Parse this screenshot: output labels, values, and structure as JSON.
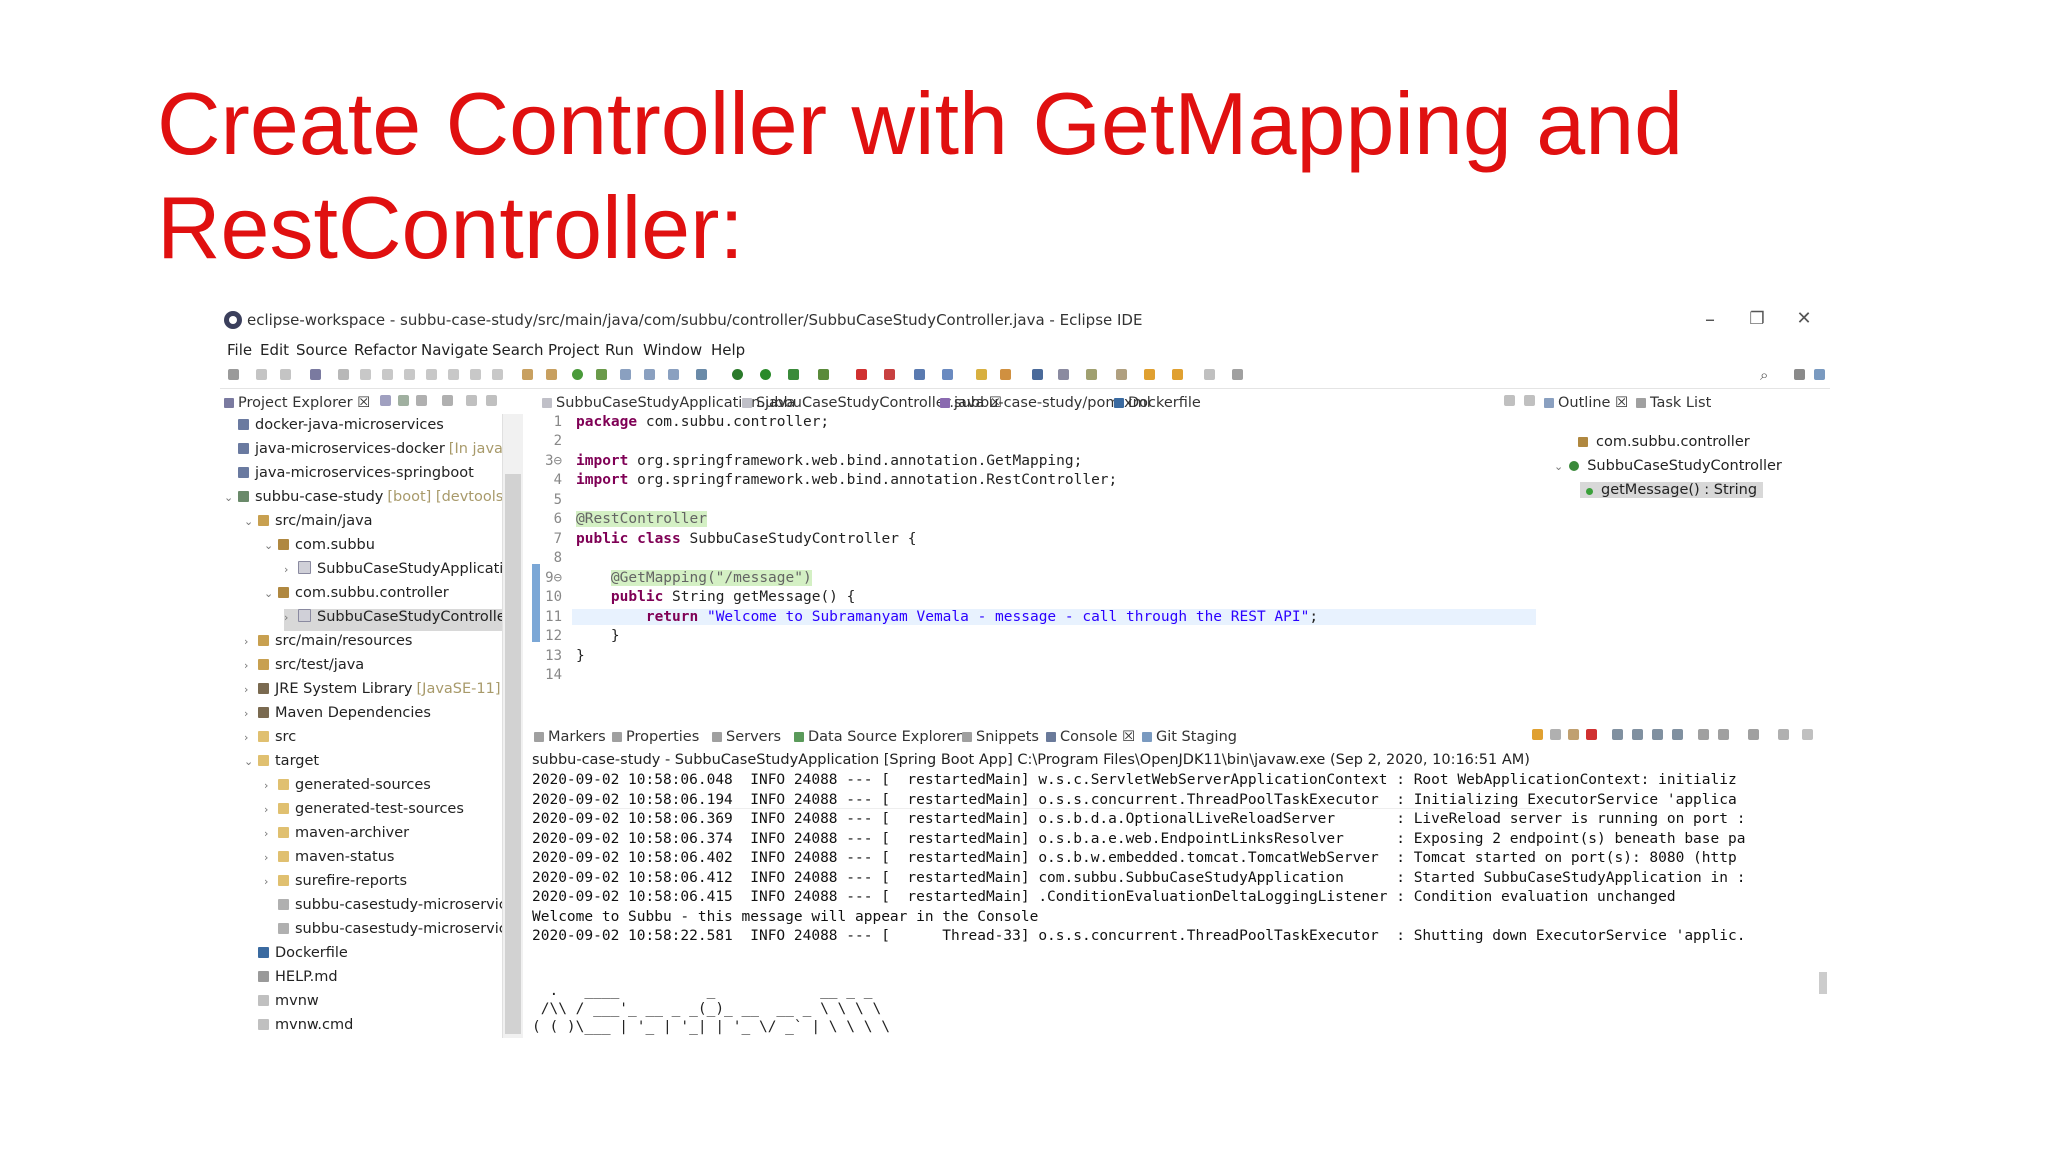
{
  "slide": {
    "title_line1": "Create Controller with GetMapping and",
    "title_line2": "RestController:"
  },
  "window": {
    "title": "eclipse-workspace - subbu-case-study/src/main/java/com/subbu/controller/SubbuCaseStudyController.java - Eclipse IDE",
    "minimize": "–",
    "restore": "❐",
    "close": "✕"
  },
  "menu": [
    "File",
    "Edit",
    "Source",
    "Refactor",
    "Navigate",
    "Search",
    "Project",
    "Run",
    "Window",
    "Help"
  ],
  "project_explorer": {
    "tab_label": "Project Explorer ☒",
    "tree": [
      {
        "label": "docker-java-microservices",
        "extra": ""
      },
      {
        "label": "java-microservices-docker",
        "extra": "[In java-n"
      },
      {
        "label": "java-microservices-springboot",
        "extra": ""
      },
      {
        "label": "subbu-case-study",
        "extra": "[boot] [devtools]"
      },
      {
        "label": "src/main/java",
        "extra": ""
      },
      {
        "label": "com.subbu",
        "extra": ""
      },
      {
        "label": "SubbuCaseStudyApplicatio",
        "extra": ""
      },
      {
        "label": "com.subbu.controller",
        "extra": ""
      },
      {
        "label": "SubbuCaseStudyController",
        "extra": ""
      },
      {
        "label": "src/main/resources",
        "extra": ""
      },
      {
        "label": "src/test/java",
        "extra": ""
      },
      {
        "label": "JRE System Library",
        "extra": "[JavaSE-11]"
      },
      {
        "label": "Maven Dependencies",
        "extra": ""
      },
      {
        "label": "src",
        "extra": ""
      },
      {
        "label": "target",
        "extra": ""
      },
      {
        "label": "generated-sources",
        "extra": ""
      },
      {
        "label": "generated-test-sources",
        "extra": ""
      },
      {
        "label": "maven-archiver",
        "extra": ""
      },
      {
        "label": "maven-status",
        "extra": ""
      },
      {
        "label": "surefire-reports",
        "extra": ""
      },
      {
        "label": "subbu-casestudy-microservic",
        "extra": ""
      },
      {
        "label": "subbu-casestudy-microservic",
        "extra": ""
      },
      {
        "label": "Dockerfile",
        "extra": ""
      },
      {
        "label": "HELP.md",
        "extra": ""
      },
      {
        "label": "mvnw",
        "extra": ""
      },
      {
        "label": "mvnw.cmd",
        "extra": ""
      }
    ]
  },
  "editor": {
    "tabs": [
      "SubbuCaseStudyApplication.java",
      "SubbuCaseStudyController.java ☒",
      "subbu-case-study/pom.xml",
      "Dockerfile"
    ],
    "line_numbers": [
      "1",
      "2",
      "3⊖",
      "4",
      "5",
      "6",
      "7",
      "8",
      "9⊖",
      "10",
      "11",
      "12",
      "13",
      "14"
    ],
    "code": {
      "l1_kw": "package",
      "l1_rest": " com.subbu.controller;",
      "l3_kw": "import",
      "l3_rest": " org.springframework.web.bind.annotation.GetMapping;",
      "l4_kw": "import",
      "l4_rest": " org.springframework.web.bind.annotation.RestController;",
      "l6_ann": "@RestController",
      "l7_kw": "public class",
      "l7_rest": " SubbuCaseStudyController {",
      "l9_indent": "    ",
      "l9_ann": "@GetMapping(\"/message\")",
      "l10_indent": "    ",
      "l10_kw": "public",
      "l10_rest": " String getMessage() {",
      "l11_indent": "        ",
      "l11_kw": "return",
      "l11_sp": " ",
      "l11_str": "\"Welcome to Subramanyam Vemala - message - call through the REST API\"",
      "l11_end": ";",
      "l12": "    }",
      "l13": "}"
    }
  },
  "outline": {
    "tabs": [
      "Outline ☒",
      "Task List"
    ],
    "items": [
      "com.subbu.controller",
      "SubbuCaseStudyController",
      "getMessage() : String"
    ]
  },
  "console": {
    "tabs": [
      "Markers",
      "Properties",
      "Servers",
      "Data Source Explorer",
      "Snippets",
      "Console ☒",
      "Git Staging"
    ],
    "description": "subbu-case-study - SubbuCaseStudyApplication [Spring Boot App] C:\\Program Files\\OpenJDK11\\bin\\javaw.exe  (Sep 2, 2020, 10:16:51 AM)",
    "lines": [
      "2020-09-02 10:58:06.048  INFO 24088 --- [  restartedMain] w.s.c.ServletWebServerApplicationContext : Root WebApplicationContext: initializ",
      "2020-09-02 10:58:06.194  INFO 24088 --- [  restartedMain] o.s.s.concurrent.ThreadPoolTaskExecutor  : Initializing ExecutorService 'applica",
      "2020-09-02 10:58:06.369  INFO 24088 --- [  restartedMain] o.s.b.d.a.OptionalLiveReloadServer       : LiveReload server is running on port :",
      "2020-09-02 10:58:06.374  INFO 24088 --- [  restartedMain] o.s.b.a.e.web.EndpointLinksResolver      : Exposing 2 endpoint(s) beneath base pa",
      "2020-09-02 10:58:06.402  INFO 24088 --- [  restartedMain] o.s.b.w.embedded.tomcat.TomcatWebServer  : Tomcat started on port(s): 8080 (http",
      "2020-09-02 10:58:06.412  INFO 24088 --- [  restartedMain] com.subbu.SubbuCaseStudyApplication      : Started SubbuCaseStudyApplication in :",
      "2020-09-02 10:58:06.415  INFO 24088 --- [  restartedMain] .ConditionEvaluationDeltaLoggingListener : Condition evaluation unchanged",
      "Welcome to Subbu - this message will appear in the Console",
      "2020-09-02 10:58:22.581  INFO 24088 --- [      Thread-33] o.s.s.concurrent.ThreadPoolTaskExecutor  : Shutting down ExecutorService 'applic."
    ],
    "ascii_art": "  .   ____          _            __ _ _\n /\\\\ / ___'_ __ _ _(_)_ __  __ _ \\ \\ \\ \\\n( ( )\\___ | '_ | '_| | '_ \\/ _` | \\ \\ \\ \\\n \\\\/  ___)| |_)| | | | | || (_| |  ) ) ) )"
  }
}
